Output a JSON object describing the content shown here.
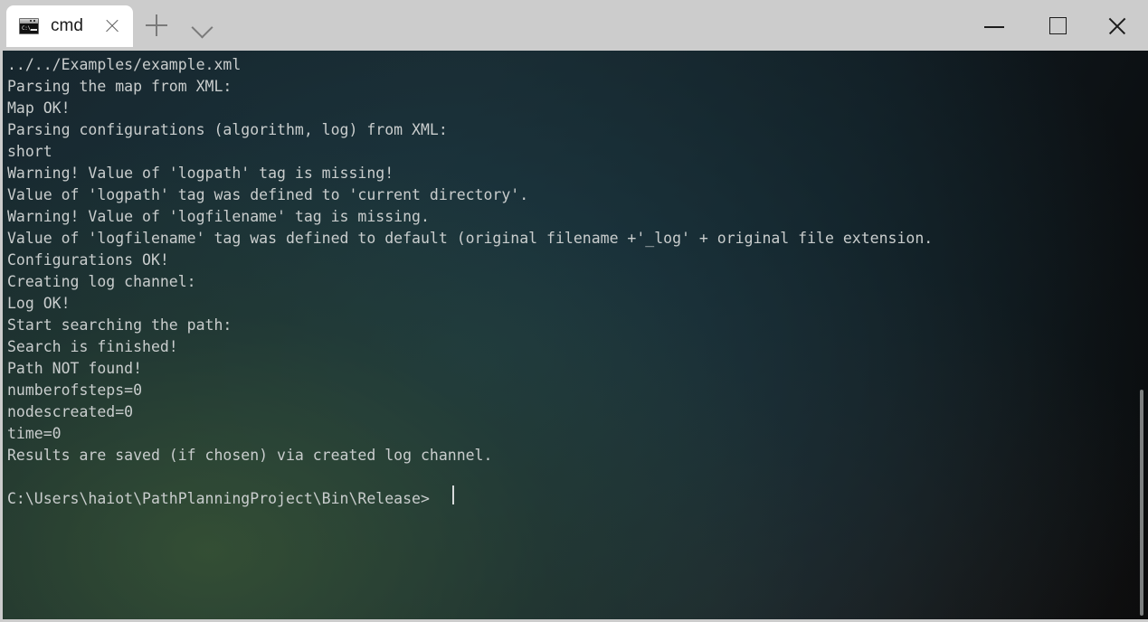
{
  "window": {
    "app_title": "cmd",
    "tab": {
      "label": "cmd",
      "icon": "console-icon",
      "icon_prompt_text": "C:\\",
      "close_icon": "close-icon"
    },
    "new_tab_icon": "plus-icon",
    "tab_menu_icon": "chevron-down-icon",
    "controls": {
      "minimize_icon": "minimize-icon",
      "maximize_icon": "maximize-icon",
      "close_icon": "close-icon"
    }
  },
  "terminal": {
    "lines": [
      "../../Examples/example.xml",
      "Parsing the map from XML:",
      "Map OK!",
      "Parsing configurations (algorithm, log) from XML:",
      "short",
      "Warning! Value of 'logpath' tag is missing!",
      "Value of 'logpath' tag was defined to 'current directory'.",
      "Warning! Value of 'logfilename' tag is missing.",
      "Value of 'logfilename' tag was defined to default (original filename +'_log' + original file extension.",
      "Configurations OK!",
      "Creating log channel:",
      "Log OK!",
      "Start searching the path:",
      "Search is finished!",
      "Path NOT found!",
      "numberofsteps=0",
      "nodescreated=0",
      "time=0",
      "Results are saved (if chosen) via created log channel.",
      "",
      "C:\\Users\\haiot\\PathPlanningProject\\Bin\\Release>"
    ],
    "prompt": "C:\\Users\\haiot\\PathPlanningProject\\Bin\\Release>",
    "results": {
      "numberofsteps": "0",
      "nodescreated": "0",
      "time": "0"
    },
    "colors": {
      "text": "#c9cdcd",
      "background": "#16232a",
      "cursor": "#d7dbdb"
    }
  }
}
